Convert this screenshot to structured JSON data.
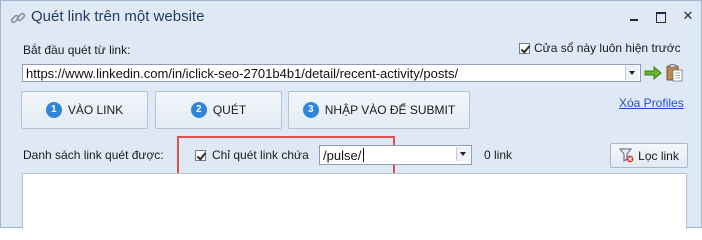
{
  "window": {
    "title": "Quét link trên một website",
    "icon": "link-icon"
  },
  "form": {
    "start_label": "Bắt đầu quét từ link:",
    "always_on_top_label": "Cửa sổ này luôn hiện trước",
    "always_on_top_checked": true,
    "url_value": "https://www.linkedin.com/in/iclick-seo-2701b4b1/detail/recent-activity/posts/"
  },
  "steps": [
    {
      "number": "1",
      "label": "VÀO LINK"
    },
    {
      "number": "2",
      "label": "QUÉT"
    },
    {
      "number": "3",
      "label": "NHẬP VÀO ĐỂ SUBMIT"
    }
  ],
  "clear_profiles_label": "Xóa Profiles",
  "list": {
    "label": "Danh sách link quét được:",
    "filter_checkbox_label": "Chỉ quét link chứa",
    "filter_checked": true,
    "filter_value": "/pulse/",
    "count_text": "0 link",
    "filter_button_label": "Lọc link"
  },
  "colors": {
    "window_bg": "#dfe9f5",
    "step_number_bg": "#2f86d8",
    "highlight_border": "#d9534f",
    "link_color": "#1f4fd1"
  }
}
